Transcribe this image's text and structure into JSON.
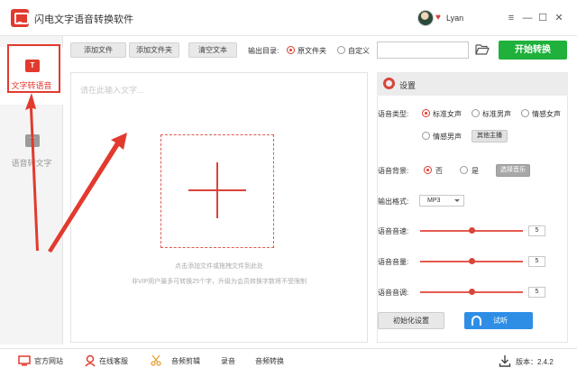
{
  "app": {
    "title": "闪电文字语音转换软件"
  },
  "user": {
    "name": "Lyan"
  },
  "window_controls": {
    "minimize": "—",
    "restore": "☐",
    "close": "✕",
    "menu": "≡"
  },
  "sidebar": {
    "items": [
      {
        "label": "文字转语音",
        "icon_text": "T",
        "active": true
      },
      {
        "label": "语音转文字",
        "icon_text": "T",
        "active": false
      }
    ]
  },
  "toolbar": {
    "add_file": "添加文件",
    "add_folder": "添加文件夹",
    "clear_text": "清空文本",
    "output_dir_label": "输出目录:",
    "output_options": [
      "原文件夹",
      "自定义"
    ],
    "output_selected": "原文件夹",
    "output_path": "",
    "start_button": "开始转换"
  },
  "editor": {
    "placeholder": "请在此输入文字...",
    "drop_hint": "点击添加文件或拖拽文件到此处",
    "vip_hint": "非VIP用户最多可转换25个字，升级为会员转换字数将不受限制"
  },
  "settings": {
    "title": "设置",
    "voice_type_label": "语音类型:",
    "voice_options": [
      "标准女声",
      "标准男声",
      "情感女声",
      "情感男声"
    ],
    "voice_selected": "标准女声",
    "other_voice_button": "其他主播",
    "background_label": "语音背景:",
    "background_options": [
      "否",
      "是"
    ],
    "background_selected": "否",
    "choose_music_button": "选择音乐",
    "format_label": "输出格式:",
    "format_value": "MP3",
    "speed_label": "语音音速:",
    "speed_value": "5",
    "volume_label": "语音音量:",
    "volume_value": "5",
    "pitch_label": "语音音调:",
    "pitch_value": "5",
    "reset_button": "初始化设置",
    "listen_button": "试听"
  },
  "footer": {
    "website": "官方网站",
    "support": "在线客服",
    "audio_edit": "音频剪辑",
    "record": "录音",
    "audio_convert": "音频转换",
    "version_label": "版本：2.4.2"
  },
  "colors": {
    "accent_red": "#e23a2e",
    "start_green": "#1fb13b",
    "listen_blue": "#2e8ee6"
  }
}
